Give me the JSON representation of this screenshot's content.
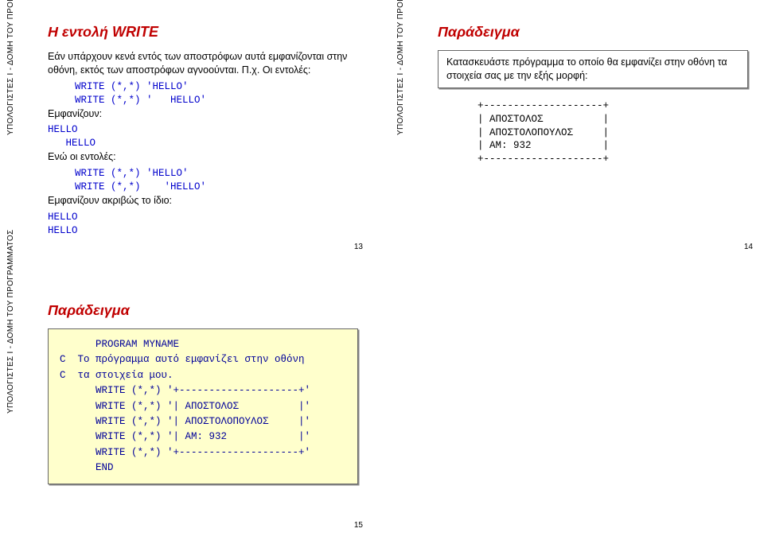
{
  "sideLabel": "ΥΠΟΛΟΓΙΣΤΕΣ Ι - ΔΟΜΗ ΤΟΥ ΠΡΟΓΡΑΜΜΑΤΟΣ",
  "slide13": {
    "title": "Η εντολή WRITE",
    "p1": "Εάν υπάρχουν κενά εντός των αποστρόφων αυτά εμφανίζονται στην οθόνη, εκτός των αποστρόφων αγνοούνται. Π.χ. Οι εντολές:",
    "c1": "WRITE (*,*) 'HELLO'",
    "c2": "WRITE (*,*) '   HELLO'",
    "p2": "Εμφανίζουν:",
    "o1": "HELLO",
    "o2": "   HELLO",
    "p3": "Ενώ οι εντολές:",
    "c3": "WRITE (*,*) 'HELLO'",
    "c4": "WRITE (*,*)    'HELLO'",
    "p4": "Εμφανίζουν ακριβώς το ίδιο:",
    "o3": "HELLO",
    "o4": "HELLO",
    "page": "13"
  },
  "slide14": {
    "title": "Παράδειγμα",
    "task": "Κατασκευάστε πρόγραμμα το οποίο θα εμφανίζει στην οθόνη τα στοιχεία σας με την εξής μορφή:",
    "out": "+--------------------+\n| ΑΠΟΣΤΟΛΟΣ          |\n| ΑΠΟΣΤΟΛΟΠΟΥΛΟΣ     |\n| ΑΜ: 932            |\n+--------------------+",
    "page": "14"
  },
  "slide15": {
    "title": "Παράδειγμα",
    "code": "      PROGRAM MYNAME\nC  Το πρόγραμμα αυτό εμφανίζει στην οθόνη\nC  τα στοιχεία μου.\n      WRITE (*,*) '+--------------------+'\n      WRITE (*,*) '| ΑΠΟΣΤΟΛΟΣ          |'\n      WRITE (*,*) '| ΑΠΟΣΤΟΛΟΠΟΥΛΟΣ     |'\n      WRITE (*,*) '| ΑΜ: 932            |'\n      WRITE (*,*) '+--------------------+'\n      END",
    "page": "15"
  }
}
